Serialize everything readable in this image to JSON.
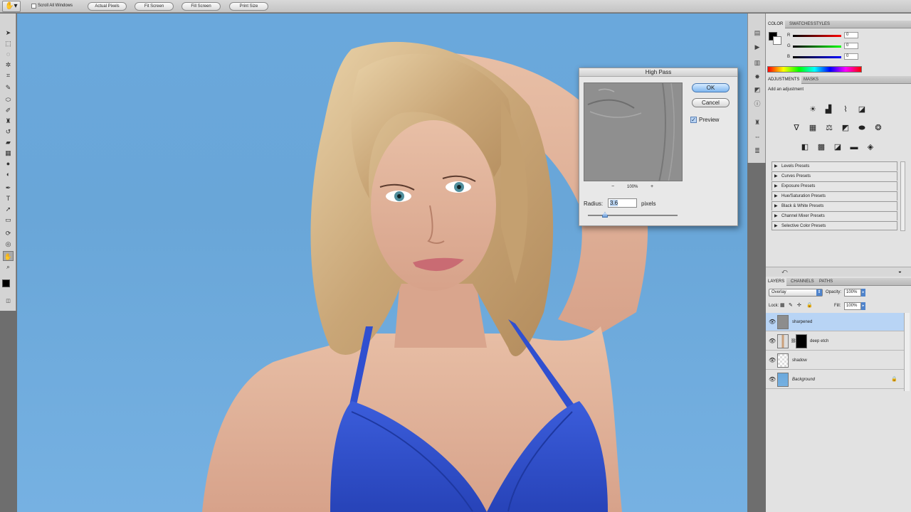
{
  "options_bar": {
    "scroll_all_windows": "Scroll All Windows",
    "buttons": [
      "Actual Pixels",
      "Fit Screen",
      "Fill Screen",
      "Print Size"
    ]
  },
  "color_panel": {
    "tabs": [
      "COLOR",
      "SWATCHES",
      "STYLES"
    ],
    "channels": [
      {
        "label": "R",
        "value": "0"
      },
      {
        "label": "G",
        "value": "0"
      },
      {
        "label": "B",
        "value": "0"
      }
    ]
  },
  "adjustments_panel": {
    "tabs": [
      "ADJUSTMENTS",
      "MASKS"
    ],
    "hint": "Add an adjustment",
    "presets": [
      "Levels Presets",
      "Curves Presets",
      "Exposure Presets",
      "Hue/Saturation Presets",
      "Black & White Presets",
      "Channel Mixer Presets",
      "Selective Color Presets"
    ]
  },
  "layers_panel": {
    "tabs": [
      "LAYERS",
      "CHANNELS",
      "PATHS"
    ],
    "blend_mode": "Overlay",
    "opacity_label": "Opacity:",
    "opacity": "100%",
    "lock_label": "Lock:",
    "fill_label": "Fill:",
    "fill": "100%",
    "layers": [
      {
        "name": "sharpened"
      },
      {
        "name": "deep etch"
      },
      {
        "name": "shadow"
      },
      {
        "name": "Background"
      }
    ]
  },
  "dialog": {
    "title": "High Pass",
    "ok": "OK",
    "cancel": "Cancel",
    "preview_label": "Preview",
    "zoom": "100%",
    "zoom_out": "−",
    "zoom_in": "+",
    "radius_label": "Radius:",
    "radius": "3.6",
    "unit": "pixels"
  },
  "colors": {
    "accent": "#b8d4f5",
    "canvas_bg": "#6aa8dc",
    "bikini": "#2f4fd0"
  }
}
